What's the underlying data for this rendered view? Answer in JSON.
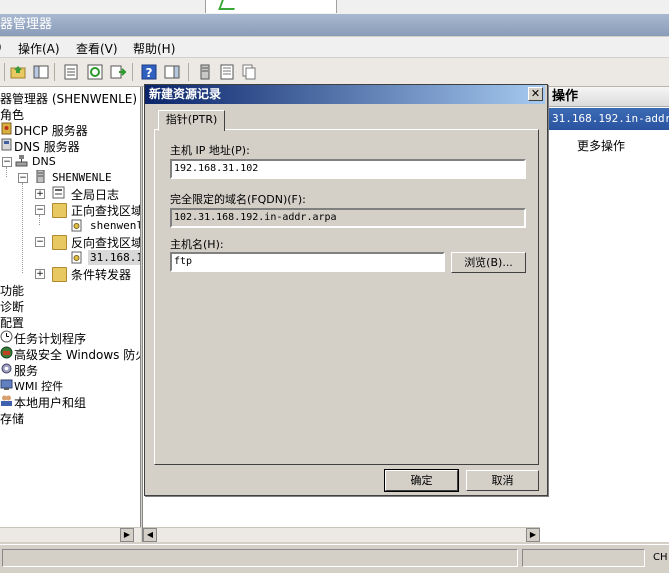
{
  "app": {
    "title": "器管理器"
  },
  "menu": {
    "items": [
      "操作(A)",
      "查看(V)",
      "帮助(H)"
    ]
  },
  "tree": {
    "root": "器管理器 (SHENWENLE)",
    "items": [
      {
        "label": "角色"
      },
      {
        "label": "DHCP 服务器"
      },
      {
        "label": "DNS 服务器"
      },
      {
        "label": "DNS"
      },
      {
        "label": "SHENWENLE"
      },
      {
        "label": "全局日志"
      },
      {
        "label": "正向查找区域"
      },
      {
        "label": "shenwenl"
      },
      {
        "label": "反向查找区域"
      },
      {
        "label": "31.168.1"
      },
      {
        "label": "条件转发器"
      },
      {
        "label": "功能"
      },
      {
        "label": "诊断"
      },
      {
        "label": "配置"
      },
      {
        "label": "任务计划程序"
      },
      {
        "label": "高级安全 Windows 防火墙"
      },
      {
        "label": "服务"
      },
      {
        "label": "WMI 控件"
      },
      {
        "label": "本地用户和组"
      },
      {
        "label": "存储"
      }
    ]
  },
  "actions": {
    "header": "操作",
    "selected": "31.168.192.in-addr",
    "more": "更多操作"
  },
  "status": {
    "lang": "CH"
  },
  "dialog": {
    "title": "新建资源记录",
    "close": "✕",
    "tab": "指针(PTR)",
    "host_ip_label": "主机 IP 地址(P):",
    "host_ip_value": "192.168.31.102",
    "fqdn_label": "完全限定的域名(FQDN)(F):",
    "fqdn_value": "102.31.168.192.in-addr.arpa",
    "hostname_label": "主机名(H):",
    "hostname_value": "ftp",
    "browse_label": "浏览(B)...",
    "ok_label": "确定",
    "cancel_label": "取消"
  }
}
